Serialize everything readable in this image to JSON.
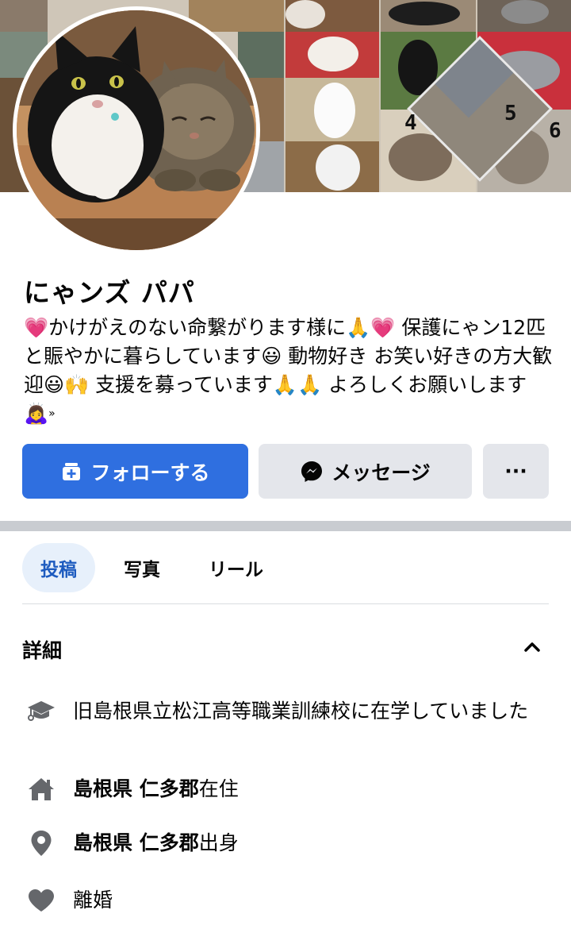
{
  "profile": {
    "name": "にゃンズ パパ",
    "bio": "💗かけがえのない命繋がります様に🙏💗 保護にゃン12匹と賑やかに暮らしています😃 動物好き お笑い好きの方大歓迎😃🙌 支援を募っています🙏🙏 よろしくお願いします🙇‍♀️",
    "bio_trailing": "»"
  },
  "actions": {
    "follow_label": "フォローする",
    "message_label": "メッセージ",
    "more_label": "···"
  },
  "tabs": [
    {
      "label": "投稿",
      "active": true
    },
    {
      "label": "写真",
      "active": false
    },
    {
      "label": "リール",
      "active": false
    }
  ],
  "details": {
    "title": "詳細",
    "items": [
      {
        "icon": "graduation-cap-icon",
        "text": "旧島根県立松江高等職業訓練校に在学していました"
      },
      {
        "icon": "home-icon",
        "bold": "島根県 仁多郡",
        "text": "在住"
      },
      {
        "icon": "location-pin-icon",
        "bold": "島根県 仁多郡",
        "text": "出身"
      },
      {
        "icon": "heart-icon",
        "text": "離婚"
      }
    ]
  },
  "cover": {
    "handwriting": [
      "4",
      "5",
      "6"
    ]
  },
  "colors": {
    "primary": "#2f6fe0",
    "tab_active_bg": "#e7f0fb",
    "tab_active_text": "#1d5bbf",
    "button_secondary": "#e4e6eb",
    "divider": "#c9ccd1",
    "icon_gray": "#65676b"
  }
}
